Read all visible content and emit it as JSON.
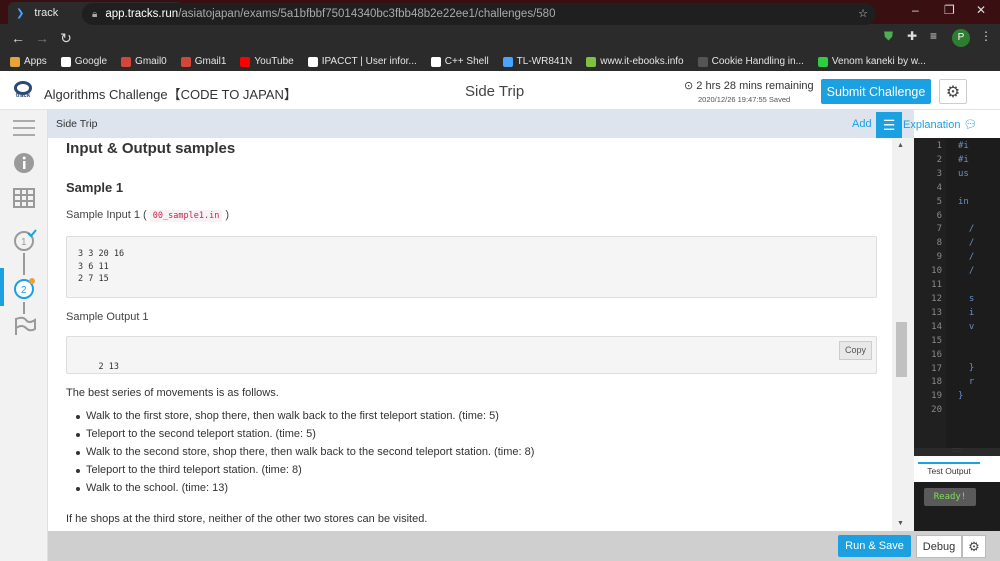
{
  "browser": {
    "tab_title": "track",
    "url_host": "app.tracks.run",
    "url_path": "/asiatojapan/exams/5a1bfbbf75014340bc3fbb48b2e22ee1/challenges/580",
    "profile_initial": "P",
    "bookmarks": [
      {
        "label": "Apps",
        "color": "#e5a33a"
      },
      {
        "label": "Google",
        "color": "#ffffff"
      },
      {
        "label": "Gmail0",
        "color": "#d44638"
      },
      {
        "label": "Gmail1",
        "color": "#d44638"
      },
      {
        "label": "YouTube",
        "color": "#ff0000"
      },
      {
        "label": "IPACCT | User infor...",
        "color": "#ffffff"
      },
      {
        "label": "C++ Shell",
        "color": "#ffffff"
      },
      {
        "label": "TL-WR841N",
        "color": "#4aa3ff"
      },
      {
        "label": "www.it-ebooks.info",
        "color": "#7fc241"
      },
      {
        "label": "Cookie Handling in...",
        "color": "#555555"
      },
      {
        "label": "Venom kaneki by w...",
        "color": "#2ecc40"
      }
    ]
  },
  "header": {
    "logo_text": "track",
    "app_title": "Algorithms Challenge【CODE TO JAPAN】",
    "challenge_title": "Side Trip",
    "time_remaining": "2 hrs 28 mins remaining",
    "saved_at": "2020/12/26 19:47:55 Saved",
    "submit_label": "Submit Challenge"
  },
  "subheader": {
    "breadcrumb": "Side Trip",
    "add_label": "Add",
    "explanation_label": "Explanation"
  },
  "content": {
    "section_title": "Input & Output samples",
    "sample_title": "Sample 1",
    "input_label": "Sample Input 1 (",
    "input_file": "00_sample1.in",
    "input_close": ")",
    "input_text": "3 3 20 16\n3 6 11\n2 7 15",
    "output_label": "Sample Output 1",
    "output_text": "2 13",
    "copy_label": "Copy",
    "intro": "The best series of movements is as follows.",
    "steps": [
      "Walk to the first store, shop there, then walk back to the first teleport station. (time: 5)",
      "Teleport to the second teleport station. (time: 5)",
      "Walk to the second store, shop there, then walk back to the second teleport station. (time: 8)",
      "Teleport to the third teleport station. (time: 8)",
      "Walk to the school. (time: 13)"
    ],
    "footer_note": "If he shops at the third store, neither of the other two stores can be visited."
  },
  "editor": {
    "line_numbers": [
      "1",
      "2",
      "3",
      "4",
      "5",
      "6",
      "7",
      "8",
      "9",
      "10",
      "11",
      "12",
      "13",
      "14",
      "15",
      "16",
      "17",
      "18",
      "19",
      "20"
    ],
    "code_lines": [
      "#i",
      "#i",
      "us",
      "",
      "in",
      "  ",
      "  /",
      "  /",
      "  /",
      "  /",
      "",
      "  s",
      "  i",
      "  v",
      "  ",
      "  ",
      "  }",
      "  r",
      "}",
      ""
    ],
    "test_output_tab": "Test Output",
    "status": "Ready!"
  },
  "footer": {
    "run_label": "Run & Save",
    "debug_label": "Debug"
  }
}
